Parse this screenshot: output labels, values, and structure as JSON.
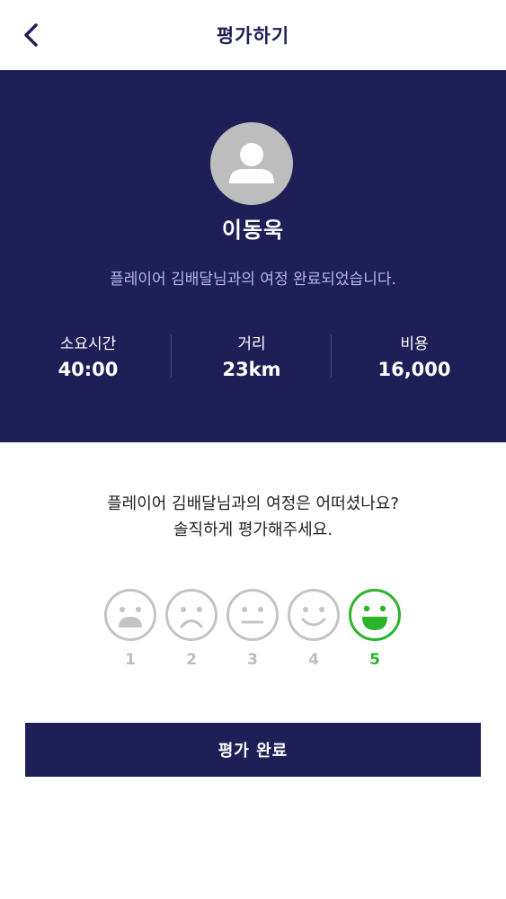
{
  "header": {
    "title": "평가하기"
  },
  "profile": {
    "name": "이동욱",
    "message": "플레이어 김배달님과의 여정 완료되었습니다."
  },
  "stats": [
    {
      "label": "소요시간",
      "value": "40:00"
    },
    {
      "label": "거리",
      "value": "23km"
    },
    {
      "label": "비용",
      "value": "16,000"
    }
  ],
  "rating": {
    "question_line1": "플레이어 김배달님과의 여정은 어떠셨나요?",
    "question_line2": "솔직하게 평가해주세요.",
    "options": [
      {
        "number": "1",
        "icon": "very-sad-face-icon"
      },
      {
        "number": "2",
        "icon": "sad-face-icon"
      },
      {
        "number": "3",
        "icon": "neutral-face-icon"
      },
      {
        "number": "4",
        "icon": "smile-face-icon"
      },
      {
        "number": "5",
        "icon": "happy-face-icon"
      }
    ],
    "selected": 5
  },
  "submit": {
    "label": "평가 완료"
  },
  "colors": {
    "primary": "#1e1f57",
    "accent_green": "#2bb52b",
    "inactive_gray": "#bdbdbd",
    "subtitle": "#b6b4f0"
  }
}
